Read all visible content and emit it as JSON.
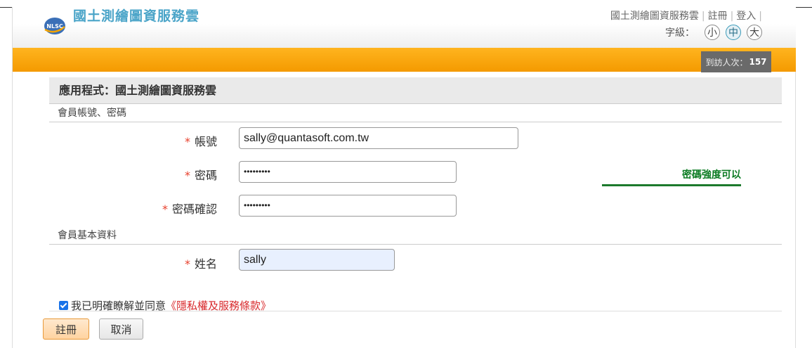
{
  "header": {
    "site_title": "國土測繪圖資服務雲",
    "logo_text": "NLSC",
    "top_links": [
      "國土測繪圖資服務雲",
      "註冊",
      "登入"
    ],
    "font_size_label": "字級：",
    "font_sizes": [
      "小",
      "中",
      "大"
    ],
    "font_size_selected": "中"
  },
  "visitor": {
    "label": "到訪人次：",
    "count": "157"
  },
  "app_title": "應用程式：國土測繪圖資服務雲",
  "account_section": {
    "title": "會員帳號、密碼",
    "account": {
      "label": "帳號",
      "value": "sally@quantasoft.com.tw"
    },
    "password": {
      "label": "密碼",
      "value": "•••••••••"
    },
    "password_confirm": {
      "label": "密碼確認",
      "value": "•••••••••"
    },
    "required_mark": "*",
    "strength_text": "密碼強度可以"
  },
  "basic_section": {
    "title": "會員基本資料",
    "name": {
      "label": "姓名",
      "value": "sally"
    }
  },
  "agreement": {
    "text": "我已明確瞭解並同意",
    "terms": "《隱私權及服務條款》",
    "checked": true
  },
  "buttons": {
    "register": "註冊",
    "cancel": "取消"
  },
  "colors": {
    "accent_orange": "#f49a00",
    "title_blue": "#4aa4c8",
    "required_red": "#e8402c",
    "strength_green": "#0b7b22"
  }
}
